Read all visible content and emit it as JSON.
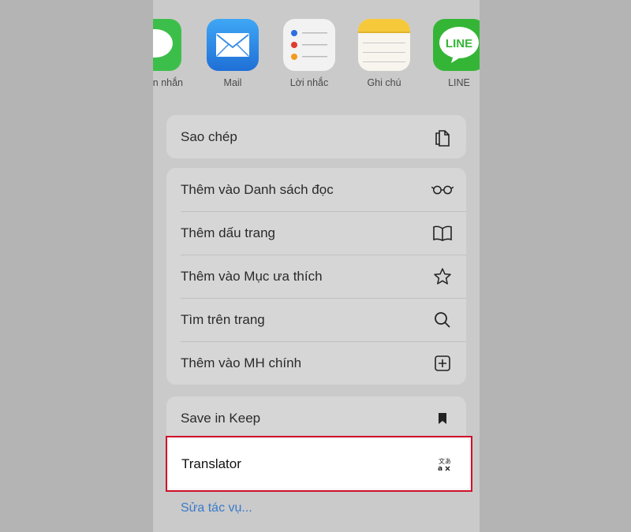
{
  "apps": [
    {
      "label": "n nhắn",
      "icon": "messages-icon",
      "color": "#3cbf4a"
    },
    {
      "label": "Mail",
      "icon": "mail-icon",
      "color": "#3a8ee6"
    },
    {
      "label": "Lời nhắc",
      "icon": "reminders-icon",
      "color": "#f2f2f2"
    },
    {
      "label": "Ghi chú",
      "icon": "notes-icon",
      "color": "#f5d24a"
    },
    {
      "label": "LINE",
      "icon": "line-icon",
      "color": "#34b536"
    }
  ],
  "groups": [
    {
      "items": [
        {
          "label": "Sao chép",
          "icon": "copy-icon"
        }
      ]
    },
    {
      "items": [
        {
          "label": "Thêm vào Danh sách đọc",
          "icon": "glasses-icon"
        },
        {
          "label": "Thêm dấu trang",
          "icon": "book-icon"
        },
        {
          "label": "Thêm vào Mục ưa thích",
          "icon": "star-icon"
        },
        {
          "label": "Tìm trên trang",
          "icon": "search-icon"
        },
        {
          "label": "Thêm vào MH chính",
          "icon": "add-square-icon"
        }
      ]
    },
    {
      "items": [
        {
          "label": "Save in Keep",
          "icon": "bookmark-icon"
        }
      ]
    }
  ],
  "translator": {
    "label": "Translator",
    "icon": "translate-icon"
  },
  "edit_actions": "Sửa tác vụ...",
  "colors": {
    "highlight_border": "#d0102a",
    "link": "#3a7ac8"
  }
}
